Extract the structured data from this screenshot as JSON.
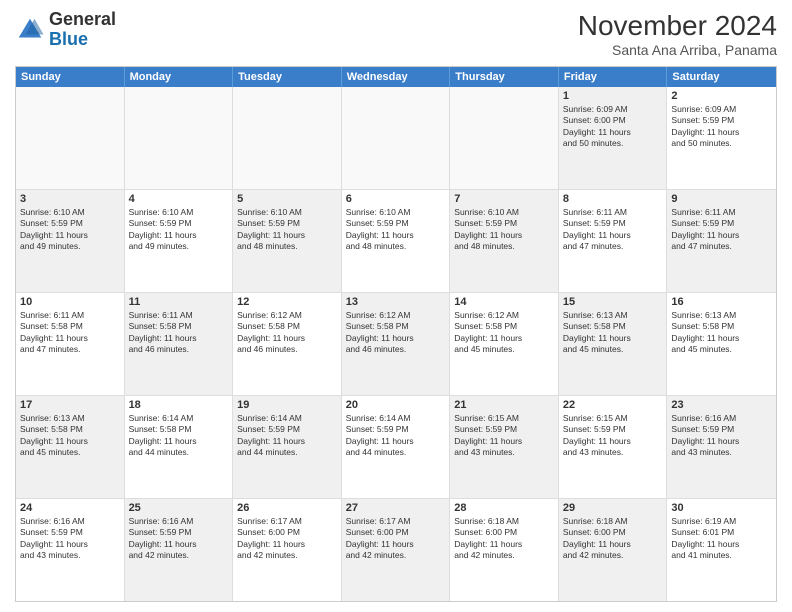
{
  "header": {
    "logo": {
      "line1": "General",
      "line2": "Blue"
    },
    "title": "November 2024",
    "subtitle": "Santa Ana Arriba, Panama"
  },
  "weekdays": [
    "Sunday",
    "Monday",
    "Tuesday",
    "Wednesday",
    "Thursday",
    "Friday",
    "Saturday"
  ],
  "rows": [
    {
      "cells": [
        {
          "day": "",
          "info": "",
          "empty": true
        },
        {
          "day": "",
          "info": "",
          "empty": true
        },
        {
          "day": "",
          "info": "",
          "empty": true
        },
        {
          "day": "",
          "info": "",
          "empty": true
        },
        {
          "day": "",
          "info": "",
          "empty": true
        },
        {
          "day": "1",
          "info": "Sunrise: 6:09 AM\nSunset: 6:00 PM\nDaylight: 11 hours\nand 50 minutes.",
          "shaded": true
        },
        {
          "day": "2",
          "info": "Sunrise: 6:09 AM\nSunset: 5:59 PM\nDaylight: 11 hours\nand 50 minutes.",
          "shaded": false
        }
      ]
    },
    {
      "cells": [
        {
          "day": "3",
          "info": "Sunrise: 6:10 AM\nSunset: 5:59 PM\nDaylight: 11 hours\nand 49 minutes.",
          "shaded": true
        },
        {
          "day": "4",
          "info": "Sunrise: 6:10 AM\nSunset: 5:59 PM\nDaylight: 11 hours\nand 49 minutes.",
          "shaded": false
        },
        {
          "day": "5",
          "info": "Sunrise: 6:10 AM\nSunset: 5:59 PM\nDaylight: 11 hours\nand 48 minutes.",
          "shaded": true
        },
        {
          "day": "6",
          "info": "Sunrise: 6:10 AM\nSunset: 5:59 PM\nDaylight: 11 hours\nand 48 minutes.",
          "shaded": false
        },
        {
          "day": "7",
          "info": "Sunrise: 6:10 AM\nSunset: 5:59 PM\nDaylight: 11 hours\nand 48 minutes.",
          "shaded": true
        },
        {
          "day": "8",
          "info": "Sunrise: 6:11 AM\nSunset: 5:59 PM\nDaylight: 11 hours\nand 47 minutes.",
          "shaded": false
        },
        {
          "day": "9",
          "info": "Sunrise: 6:11 AM\nSunset: 5:59 PM\nDaylight: 11 hours\nand 47 minutes.",
          "shaded": true
        }
      ]
    },
    {
      "cells": [
        {
          "day": "10",
          "info": "Sunrise: 6:11 AM\nSunset: 5:58 PM\nDaylight: 11 hours\nand 47 minutes.",
          "shaded": false
        },
        {
          "day": "11",
          "info": "Sunrise: 6:11 AM\nSunset: 5:58 PM\nDaylight: 11 hours\nand 46 minutes.",
          "shaded": true
        },
        {
          "day": "12",
          "info": "Sunrise: 6:12 AM\nSunset: 5:58 PM\nDaylight: 11 hours\nand 46 minutes.",
          "shaded": false
        },
        {
          "day": "13",
          "info": "Sunrise: 6:12 AM\nSunset: 5:58 PM\nDaylight: 11 hours\nand 46 minutes.",
          "shaded": true
        },
        {
          "day": "14",
          "info": "Sunrise: 6:12 AM\nSunset: 5:58 PM\nDaylight: 11 hours\nand 45 minutes.",
          "shaded": false
        },
        {
          "day": "15",
          "info": "Sunrise: 6:13 AM\nSunset: 5:58 PM\nDaylight: 11 hours\nand 45 minutes.",
          "shaded": true
        },
        {
          "day": "16",
          "info": "Sunrise: 6:13 AM\nSunset: 5:58 PM\nDaylight: 11 hours\nand 45 minutes.",
          "shaded": false
        }
      ]
    },
    {
      "cells": [
        {
          "day": "17",
          "info": "Sunrise: 6:13 AM\nSunset: 5:58 PM\nDaylight: 11 hours\nand 45 minutes.",
          "shaded": true
        },
        {
          "day": "18",
          "info": "Sunrise: 6:14 AM\nSunset: 5:58 PM\nDaylight: 11 hours\nand 44 minutes.",
          "shaded": false
        },
        {
          "day": "19",
          "info": "Sunrise: 6:14 AM\nSunset: 5:59 PM\nDaylight: 11 hours\nand 44 minutes.",
          "shaded": true
        },
        {
          "day": "20",
          "info": "Sunrise: 6:14 AM\nSunset: 5:59 PM\nDaylight: 11 hours\nand 44 minutes.",
          "shaded": false
        },
        {
          "day": "21",
          "info": "Sunrise: 6:15 AM\nSunset: 5:59 PM\nDaylight: 11 hours\nand 43 minutes.",
          "shaded": true
        },
        {
          "day": "22",
          "info": "Sunrise: 6:15 AM\nSunset: 5:59 PM\nDaylight: 11 hours\nand 43 minutes.",
          "shaded": false
        },
        {
          "day": "23",
          "info": "Sunrise: 6:16 AM\nSunset: 5:59 PM\nDaylight: 11 hours\nand 43 minutes.",
          "shaded": true
        }
      ]
    },
    {
      "cells": [
        {
          "day": "24",
          "info": "Sunrise: 6:16 AM\nSunset: 5:59 PM\nDaylight: 11 hours\nand 43 minutes.",
          "shaded": false
        },
        {
          "day": "25",
          "info": "Sunrise: 6:16 AM\nSunset: 5:59 PM\nDaylight: 11 hours\nand 42 minutes.",
          "shaded": true
        },
        {
          "day": "26",
          "info": "Sunrise: 6:17 AM\nSunset: 6:00 PM\nDaylight: 11 hours\nand 42 minutes.",
          "shaded": false
        },
        {
          "day": "27",
          "info": "Sunrise: 6:17 AM\nSunset: 6:00 PM\nDaylight: 11 hours\nand 42 minutes.",
          "shaded": true
        },
        {
          "day": "28",
          "info": "Sunrise: 6:18 AM\nSunset: 6:00 PM\nDaylight: 11 hours\nand 42 minutes.",
          "shaded": false
        },
        {
          "day": "29",
          "info": "Sunrise: 6:18 AM\nSunset: 6:00 PM\nDaylight: 11 hours\nand 42 minutes.",
          "shaded": true
        },
        {
          "day": "30",
          "info": "Sunrise: 6:19 AM\nSunset: 6:01 PM\nDaylight: 11 hours\nand 41 minutes.",
          "shaded": false
        }
      ]
    }
  ]
}
